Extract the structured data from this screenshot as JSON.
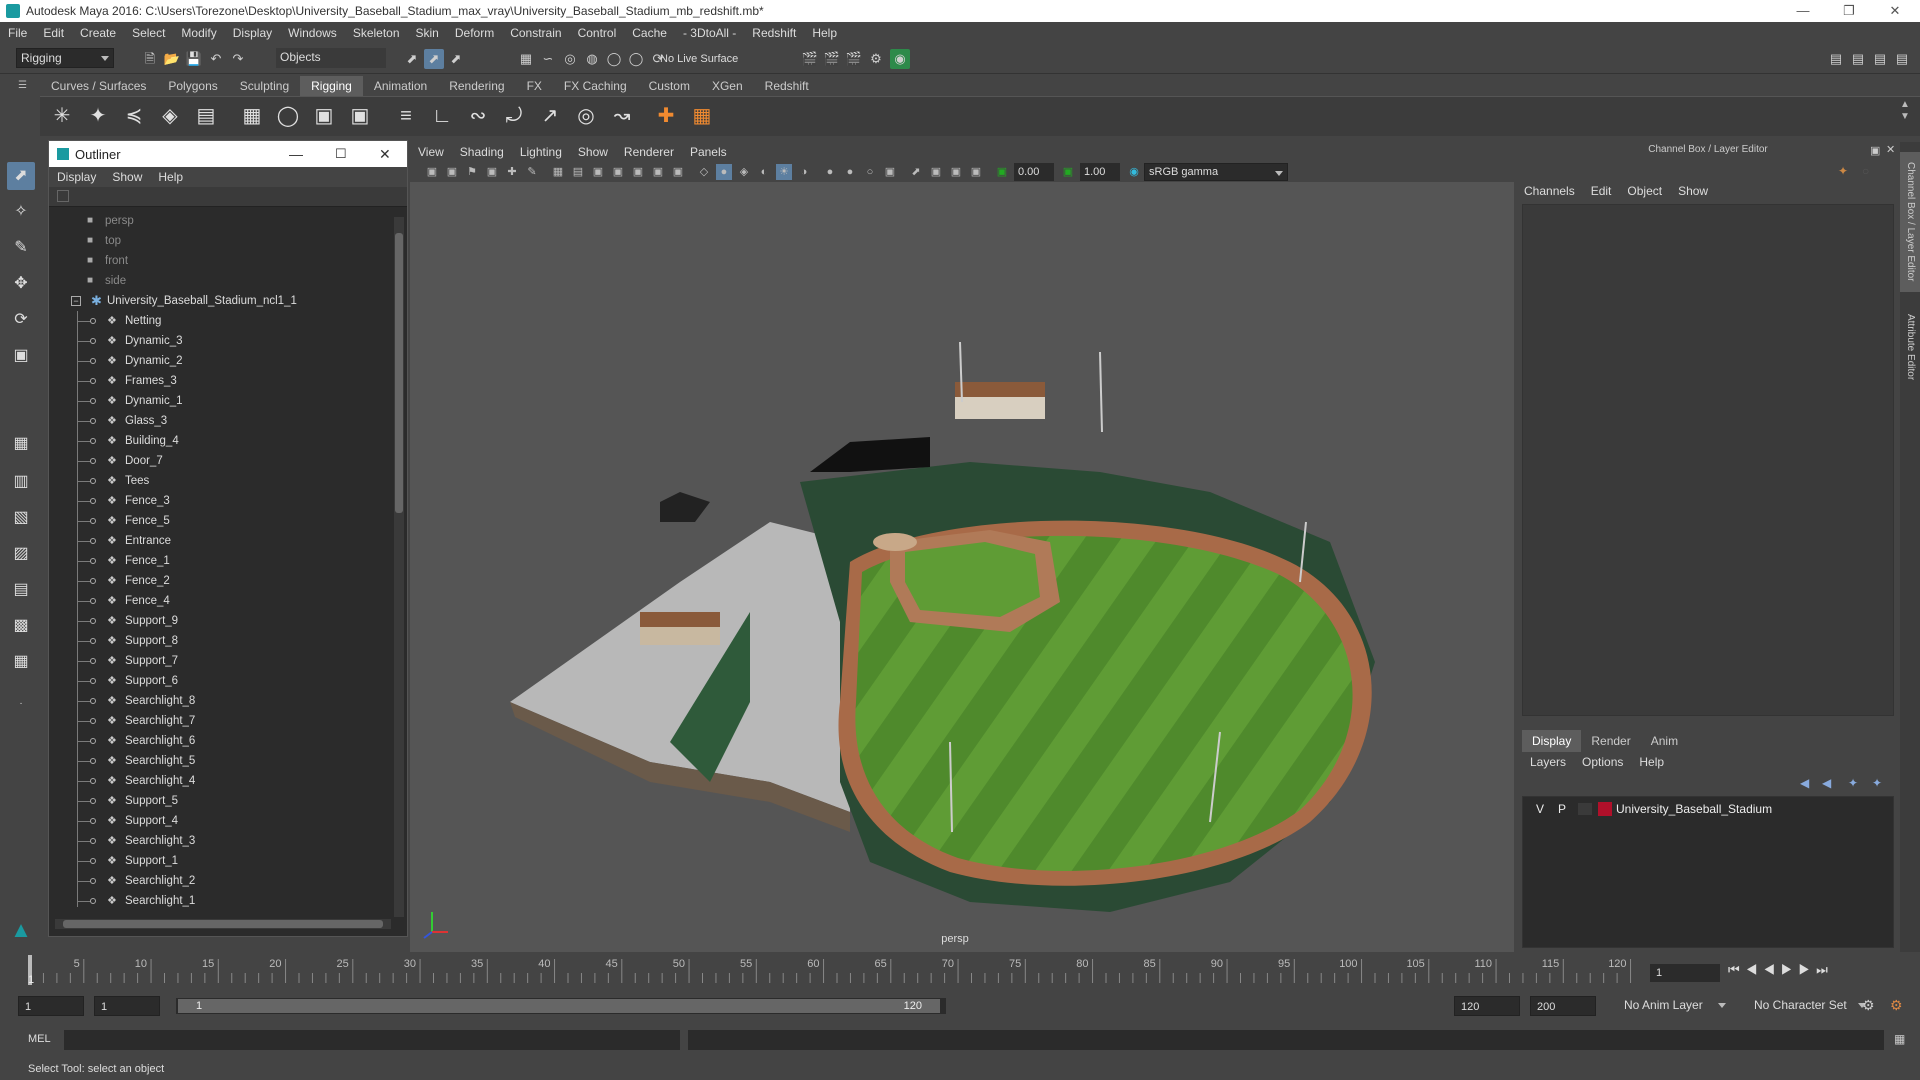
{
  "app": {
    "title": "Autodesk Maya 2016: C:\\Users\\Torezone\\Desktop\\University_Baseball_Stadium_max_vray\\University_Baseball_Stadium_mb_redshift.mb*"
  },
  "menubar": [
    "File",
    "Edit",
    "Create",
    "Select",
    "Modify",
    "Display",
    "Windows",
    "Skeleton",
    "Skin",
    "Deform",
    "Constrain",
    "Control",
    "Cache",
    "- 3DtoAll -",
    "Redshift",
    "Help"
  ],
  "status": {
    "mode": "Rigging",
    "objects": "Objects",
    "live_surface": "No Live Surface"
  },
  "shelf_tabs": [
    "Curves / Surfaces",
    "Polygons",
    "Sculpting",
    "Rigging",
    "Animation",
    "Rendering",
    "FX",
    "FX Caching",
    "Custom",
    "XGen",
    "Redshift"
  ],
  "outliner": {
    "title": "Outliner",
    "menu": [
      "Display",
      "Show",
      "Help"
    ],
    "cameras": [
      "persp",
      "top",
      "front",
      "side"
    ],
    "root": "University_Baseball_Stadium_ncl1_1",
    "children": [
      "Netting",
      "Dynamic_3",
      "Dynamic_2",
      "Frames_3",
      "Dynamic_1",
      "Glass_3",
      "Building_4",
      "Door_7",
      "Tees",
      "Fence_3",
      "Fence_5",
      "Entrance",
      "Fence_1",
      "Fence_2",
      "Fence_4",
      "Support_9",
      "Support_8",
      "Support_7",
      "Support_6",
      "Searchlight_8",
      "Searchlight_7",
      "Searchlight_6",
      "Searchlight_5",
      "Searchlight_4",
      "Support_5",
      "Support_4",
      "Searchlight_3",
      "Support_1",
      "Searchlight_2",
      "Searchlight_1"
    ]
  },
  "viewport": {
    "menu": [
      "View",
      "Shading",
      "Lighting",
      "Show",
      "Renderer",
      "Panels"
    ],
    "exposure": "0.00",
    "gamma": "1.00",
    "colorspace": "sRGB gamma",
    "camera": "persp"
  },
  "channelbox": {
    "title": "Channel Box / Layer Editor",
    "menu": [
      "Channels",
      "Edit",
      "Object",
      "Show"
    ],
    "layer_tabs": [
      "Display",
      "Render",
      "Anim"
    ],
    "layer_menu": [
      "Layers",
      "Options",
      "Help"
    ],
    "layer": {
      "v": "V",
      "p": "P",
      "name": "University_Baseball_Stadium",
      "color": "#b0102a"
    },
    "side_tabs": [
      "Channel Box / Layer Editor",
      "Attribute Editor"
    ]
  },
  "timeline": {
    "ticks": [
      "5",
      "10",
      "15",
      "20",
      "25",
      "30",
      "35",
      "40",
      "45",
      "50",
      "55",
      "60",
      "65",
      "70",
      "75",
      "80",
      "85",
      "90",
      "95",
      "100",
      "105",
      "110",
      "115",
      "120"
    ],
    "start_marker": "1",
    "current": "1"
  },
  "range": {
    "start": "1",
    "start2": "1",
    "slider_start": "1",
    "slider_end": "120",
    "end": "120",
    "max": "200",
    "anim_layer": "No Anim Layer",
    "char_set": "No Character Set"
  },
  "cmd": {
    "label": "MEL"
  },
  "help": {
    "text": "Select Tool: select an object"
  }
}
